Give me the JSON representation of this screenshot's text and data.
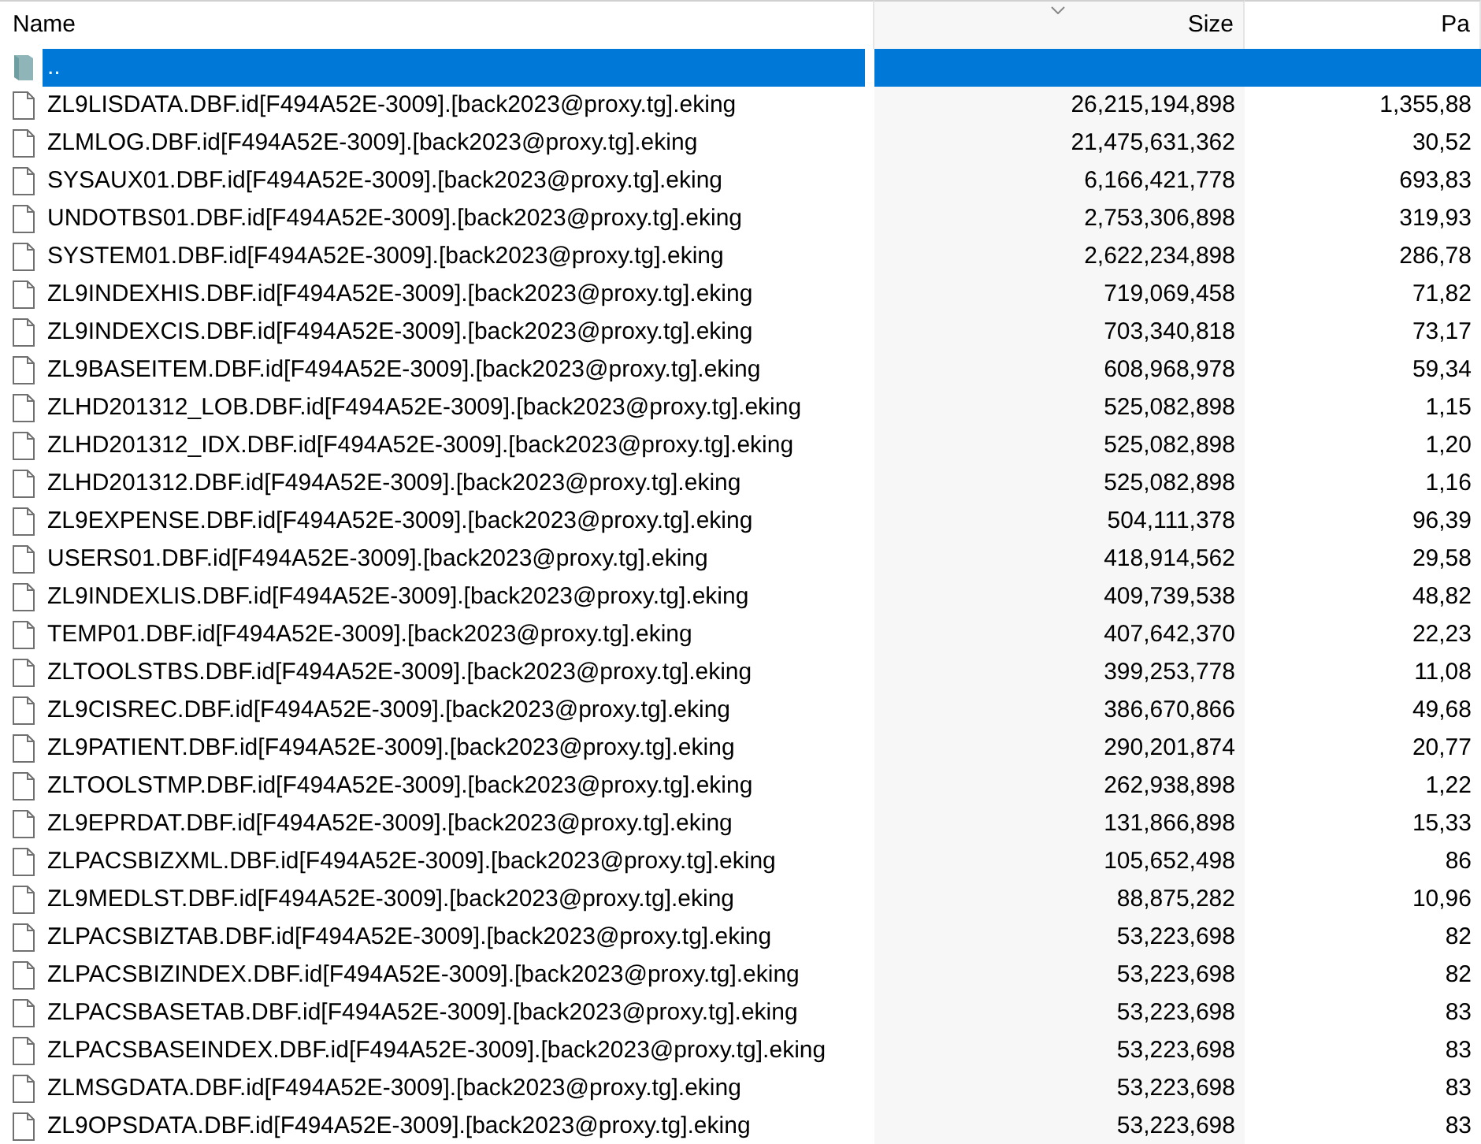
{
  "columns": [
    {
      "label": "Name",
      "sorted": false
    },
    {
      "label": "Size",
      "sorted": true
    },
    {
      "label": "Pa",
      "sorted": false
    }
  ],
  "rows": [
    {
      "kind": "parent",
      "name": "..",
      "size": "",
      "packed": "",
      "selected": true
    },
    {
      "kind": "file",
      "name": "ZL9LISDATA.DBF.id[F494A52E-3009].[back2023@proxy.tg].eking",
      "size": "26,215,194,898",
      "packed": "1,355,88",
      "selected": false
    },
    {
      "kind": "file",
      "name": "ZLMLOG.DBF.id[F494A52E-3009].[back2023@proxy.tg].eking",
      "size": "21,475,631,362",
      "packed": "30,52",
      "selected": false
    },
    {
      "kind": "file",
      "name": "SYSAUX01.DBF.id[F494A52E-3009].[back2023@proxy.tg].eking",
      "size": "6,166,421,778",
      "packed": "693,83",
      "selected": false
    },
    {
      "kind": "file",
      "name": "UNDOTBS01.DBF.id[F494A52E-3009].[back2023@proxy.tg].eking",
      "size": "2,753,306,898",
      "packed": "319,93",
      "selected": false
    },
    {
      "kind": "file",
      "name": "SYSTEM01.DBF.id[F494A52E-3009].[back2023@proxy.tg].eking",
      "size": "2,622,234,898",
      "packed": "286,78",
      "selected": false
    },
    {
      "kind": "file",
      "name": "ZL9INDEXHIS.DBF.id[F494A52E-3009].[back2023@proxy.tg].eking",
      "size": "719,069,458",
      "packed": "71,82",
      "selected": false
    },
    {
      "kind": "file",
      "name": "ZL9INDEXCIS.DBF.id[F494A52E-3009].[back2023@proxy.tg].eking",
      "size": "703,340,818",
      "packed": "73,17",
      "selected": false
    },
    {
      "kind": "file",
      "name": "ZL9BASEITEM.DBF.id[F494A52E-3009].[back2023@proxy.tg].eking",
      "size": "608,968,978",
      "packed": "59,34",
      "selected": false
    },
    {
      "kind": "file",
      "name": "ZLHD201312_LOB.DBF.id[F494A52E-3009].[back2023@proxy.tg].eking",
      "size": "525,082,898",
      "packed": "1,15",
      "selected": false
    },
    {
      "kind": "file",
      "name": "ZLHD201312_IDX.DBF.id[F494A52E-3009].[back2023@proxy.tg].eking",
      "size": "525,082,898",
      "packed": "1,20",
      "selected": false
    },
    {
      "kind": "file",
      "name": "ZLHD201312.DBF.id[F494A52E-3009].[back2023@proxy.tg].eking",
      "size": "525,082,898",
      "packed": "1,16",
      "selected": false
    },
    {
      "kind": "file",
      "name": "ZL9EXPENSE.DBF.id[F494A52E-3009].[back2023@proxy.tg].eking",
      "size": "504,111,378",
      "packed": "96,39",
      "selected": false
    },
    {
      "kind": "file",
      "name": "USERS01.DBF.id[F494A52E-3009].[back2023@proxy.tg].eking",
      "size": "418,914,562",
      "packed": "29,58",
      "selected": false
    },
    {
      "kind": "file",
      "name": "ZL9INDEXLIS.DBF.id[F494A52E-3009].[back2023@proxy.tg].eking",
      "size": "409,739,538",
      "packed": "48,82",
      "selected": false
    },
    {
      "kind": "file",
      "name": "TEMP01.DBF.id[F494A52E-3009].[back2023@proxy.tg].eking",
      "size": "407,642,370",
      "packed": "22,23",
      "selected": false
    },
    {
      "kind": "file",
      "name": "ZLTOOLSTBS.DBF.id[F494A52E-3009].[back2023@proxy.tg].eking",
      "size": "399,253,778",
      "packed": "11,08",
      "selected": false
    },
    {
      "kind": "file",
      "name": "ZL9CISREC.DBF.id[F494A52E-3009].[back2023@proxy.tg].eking",
      "size": "386,670,866",
      "packed": "49,68",
      "selected": false
    },
    {
      "kind": "file",
      "name": "ZL9PATIENT.DBF.id[F494A52E-3009].[back2023@proxy.tg].eking",
      "size": "290,201,874",
      "packed": "20,77",
      "selected": false
    },
    {
      "kind": "file",
      "name": "ZLTOOLSTMP.DBF.id[F494A52E-3009].[back2023@proxy.tg].eking",
      "size": "262,938,898",
      "packed": "1,22",
      "selected": false
    },
    {
      "kind": "file",
      "name": "ZL9EPRDAT.DBF.id[F494A52E-3009].[back2023@proxy.tg].eking",
      "size": "131,866,898",
      "packed": "15,33",
      "selected": false
    },
    {
      "kind": "file",
      "name": "ZLPACSBIZXML.DBF.id[F494A52E-3009].[back2023@proxy.tg].eking",
      "size": "105,652,498",
      "packed": "86",
      "selected": false
    },
    {
      "kind": "file",
      "name": "ZL9MEDLST.DBF.id[F494A52E-3009].[back2023@proxy.tg].eking",
      "size": "88,875,282",
      "packed": "10,96",
      "selected": false
    },
    {
      "kind": "file",
      "name": "ZLPACSBIZTAB.DBF.id[F494A52E-3009].[back2023@proxy.tg].eking",
      "size": "53,223,698",
      "packed": "82",
      "selected": false
    },
    {
      "kind": "file",
      "name": "ZLPACSBIZINDEX.DBF.id[F494A52E-3009].[back2023@proxy.tg].eking",
      "size": "53,223,698",
      "packed": "82",
      "selected": false
    },
    {
      "kind": "file",
      "name": "ZLPACSBASETAB.DBF.id[F494A52E-3009].[back2023@proxy.tg].eking",
      "size": "53,223,698",
      "packed": "83",
      "selected": false
    },
    {
      "kind": "file",
      "name": "ZLPACSBASEINDEX.DBF.id[F494A52E-3009].[back2023@proxy.tg].eking",
      "size": "53,223,698",
      "packed": "83",
      "selected": false
    },
    {
      "kind": "file",
      "name": "ZLMSGDATA.DBF.id[F494A52E-3009].[back2023@proxy.tg].eking",
      "size": "53,223,698",
      "packed": "83",
      "selected": false
    },
    {
      "kind": "file",
      "name": "ZL9OPSDATA.DBF.id[F494A52E-3009].[back2023@proxy.tg].eking",
      "size": "53,223,698",
      "packed": "83",
      "selected": false
    }
  ]
}
